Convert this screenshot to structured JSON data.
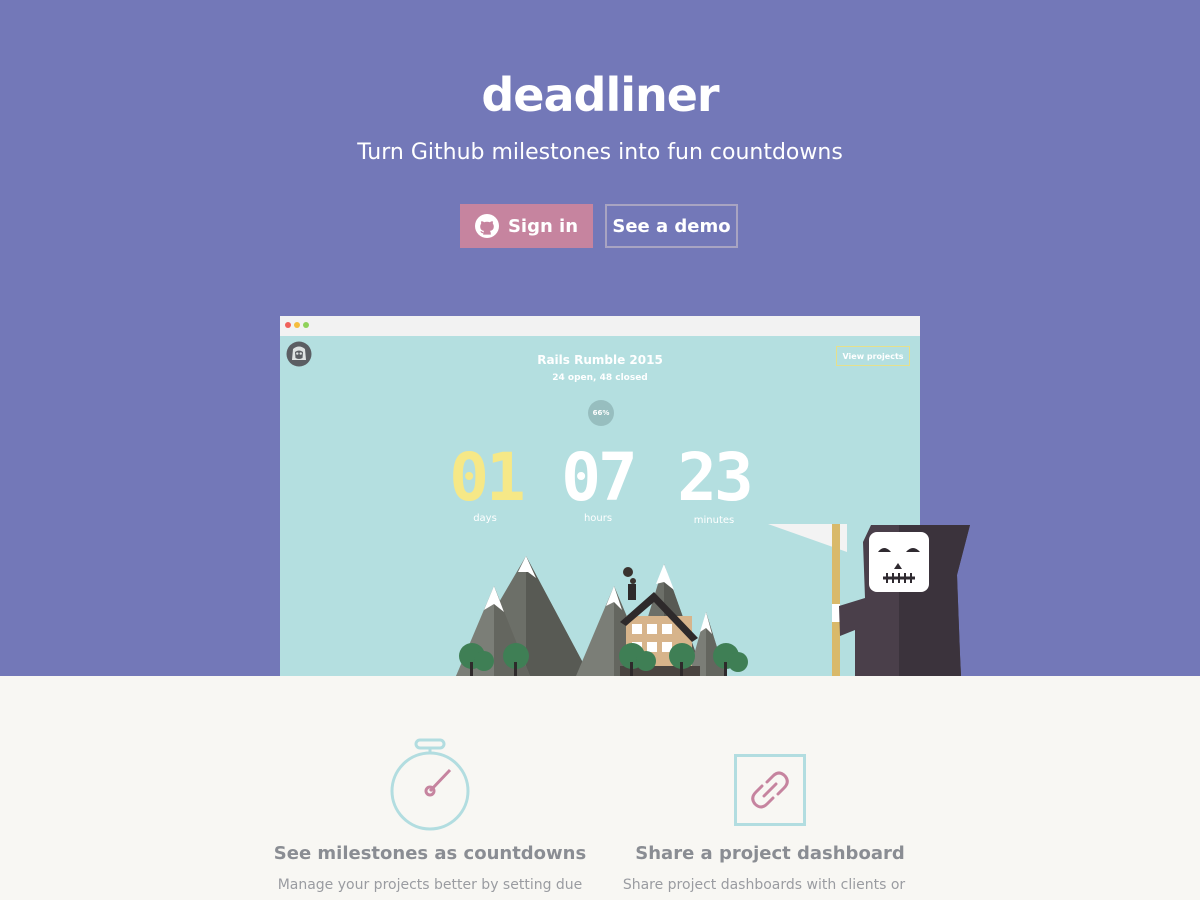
{
  "brand": {
    "name": "deadliner",
    "tagline": "Turn Github milestones into fun countdowns"
  },
  "actions": {
    "signin_label": "Sign in",
    "demo_label": "See a demo"
  },
  "preview": {
    "project_title": "Rails Rumble 2015",
    "issue_summary": "24 open, 48 closed",
    "progress_label": "66%",
    "progress": 0.66,
    "view_projects_label": "View projects",
    "countdown": {
      "days": "01",
      "days_label": "days",
      "hours": "07",
      "hours_label": "hours",
      "minutes": "23",
      "minutes_label": "minutes"
    }
  },
  "features": [
    {
      "icon": "stopwatch-icon",
      "title": "See milestones as countdowns",
      "desc": "Manage your projects better by setting due"
    },
    {
      "icon": "link-icon",
      "title": "Share a project dashboard",
      "desc": "Share project dashboards with clients or"
    }
  ],
  "colors": {
    "hero_bg": "#7378b8",
    "signin_bg": "#c6849f",
    "preview_bg": "#b4dfe0",
    "days_color": "#f6e887",
    "page_bg": "#f8f7f3",
    "feature_icon": "#b2dde0",
    "feature_accent": "#c6849f"
  }
}
